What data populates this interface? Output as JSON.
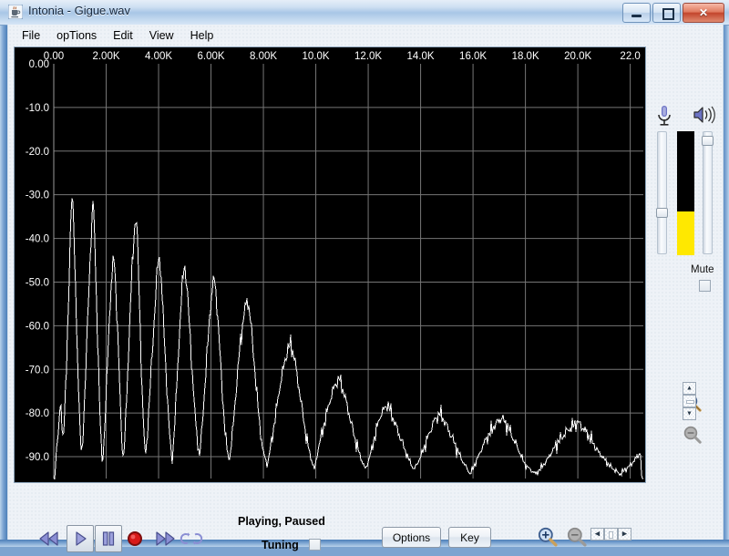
{
  "window": {
    "title": "Intonia - Gigue.wav",
    "icon": "java-cup-icon",
    "minimize_label": "Minimize",
    "maximize_label": "Maximize",
    "close_label": "Close",
    "close_glyph": "✕"
  },
  "menubar": {
    "items": [
      {
        "label": "File",
        "name": "menu-file"
      },
      {
        "label": "opTions",
        "name": "menu-options"
      },
      {
        "label": "Edit",
        "name": "menu-edit"
      },
      {
        "label": "View",
        "name": "menu-view"
      },
      {
        "label": "Help",
        "name": "menu-help"
      }
    ]
  },
  "chart_data": {
    "type": "line",
    "title": "",
    "xlabel": "",
    "ylabel": "",
    "xlim": [
      0,
      22500
    ],
    "ylim": [
      -95,
      0
    ],
    "grid": true,
    "legend": false,
    "background": "#000000",
    "line_color": "#ffffff",
    "grid_color": "#767676",
    "xticks": [
      0,
      2000,
      4000,
      6000,
      8000,
      10000,
      12000,
      14000,
      16000,
      18000,
      20000,
      22000
    ],
    "xtick_labels": [
      "0.00",
      "2.00K",
      "4.00K",
      "6.00K",
      "8.00K",
      "10.0K",
      "12.0K",
      "14.0K",
      "16.0K",
      "18.0K",
      "20.0K",
      "22.0"
    ],
    "yticks": [
      0,
      -10,
      -20,
      -30,
      -40,
      -50,
      -60,
      -70,
      -80,
      -90
    ],
    "ytick_labels": [
      "0.00",
      "-10.0",
      "-20.0",
      "-30.0",
      "-40.0",
      "-50.0",
      "-60.0",
      "-70.0",
      "-80.0",
      "-90.0"
    ],
    "series": [
      {
        "name": "spectrum",
        "x": [
          60,
          100,
          140,
          180,
          220,
          260,
          300,
          340,
          380,
          420,
          460,
          500,
          540,
          580,
          620,
          660,
          700,
          740,
          780,
          820,
          860,
          900,
          940,
          980,
          1020,
          1060,
          1100,
          1140,
          1180,
          1220,
          1260,
          1300,
          1340,
          1380,
          1420,
          1460,
          1500,
          1540,
          1580,
          1620,
          1660,
          1700,
          1740,
          1780,
          1820,
          1860,
          1900,
          1940,
          1980,
          2020,
          2060,
          2100,
          2140,
          2180,
          2220,
          2260,
          2300,
          2340,
          2380,
          2420,
          2460,
          2500,
          2540,
          2580,
          2620,
          2660,
          2700,
          2740,
          2780,
          2820,
          2860,
          2900,
          2940,
          2980,
          3020,
          3060,
          3100,
          3140,
          3180,
          3220,
          3260,
          3300,
          3340,
          3380,
          3420,
          3460,
          3500,
          3560,
          3620,
          3680,
          3740,
          3800,
          3860,
          3920,
          3980,
          4040,
          4100,
          4160,
          4220,
          4280,
          4340,
          4400,
          4460,
          4520,
          4580,
          4640,
          4700,
          4760,
          4820,
          4880,
          4940,
          5000,
          5080,
          5160,
          5240,
          5320,
          5400,
          5480,
          5560,
          5640,
          5720,
          5800,
          5880,
          5960,
          6040,
          6120,
          6200,
          6280,
          6360,
          6440,
          6520,
          6600,
          6700,
          6800,
          6900,
          7000,
          7100,
          7200,
          7300,
          7400,
          7500,
          7600,
          7700,
          7800,
          7900,
          8000,
          8150,
          8300,
          8450,
          8600,
          8750,
          8900,
          9050,
          9200,
          9350,
          9500,
          9650,
          9800,
          9950,
          10100,
          10300,
          10500,
          10700,
          10900,
          11100,
          11300,
          11500,
          11700,
          11900,
          12100,
          12300,
          12500,
          12750,
          13000,
          13250,
          13500,
          13750,
          14000,
          14250,
          14500,
          14750,
          15000,
          15300,
          15600,
          15900,
          16200,
          16500,
          16800,
          17100,
          17400,
          17700,
          18000,
          18400,
          18800,
          19200,
          19600,
          20000,
          20400,
          20800,
          21200,
          21600,
          22000,
          22400
        ],
        "y": [
          -93,
          -89,
          -86,
          -84,
          -80,
          -76,
          -82,
          -87,
          -84,
          -79,
          -72,
          -66,
          -60,
          -52,
          -42,
          -34,
          -28.5,
          -33,
          -41,
          -50,
          -58,
          -66,
          -73,
          -80,
          -86,
          -90,
          -87,
          -82,
          -76,
          -70,
          -64,
          -58,
          -52,
          -46,
          -40,
          -35.5,
          -31,
          -36,
          -44,
          -52,
          -60,
          -68,
          -76,
          -83,
          -89,
          -92,
          -88,
          -84,
          -79,
          -73,
          -67,
          -61,
          -56,
          -52,
          -49,
          -46,
          -44,
          -48,
          -53,
          -59,
          -65,
          -71,
          -78,
          -84,
          -88,
          -91,
          -87,
          -82,
          -77,
          -71,
          -65,
          -59,
          -53,
          -48,
          -44,
          -40,
          -36.5,
          -34.5,
          -38,
          -45,
          -53,
          -61,
          -69,
          -76,
          -82,
          -87,
          -90,
          -86,
          -80,
          -74,
          -68,
          -62,
          -56,
          -50,
          -45,
          -44.5,
          -49,
          -56,
          -63,
          -70,
          -77,
          -83,
          -88,
          -91,
          -86,
          -80,
          -73,
          -66,
          -59,
          -53,
          -48,
          -46,
          -51,
          -58,
          -66,
          -74,
          -81,
          -86,
          -90,
          -85,
          -78,
          -71,
          -64,
          -57,
          -52,
          -49,
          -53,
          -60,
          -68,
          -76,
          -83,
          -88,
          -91,
          -86,
          -79,
          -72,
          -65,
          -60,
          -56,
          -54,
          -58,
          -65,
          -72,
          -79,
          -85,
          -89,
          -92,
          -87,
          -81,
          -75,
          -70,
          -66,
          -64,
          -68,
          -74,
          -80,
          -86,
          -90,
          -93,
          -88,
          -83,
          -78,
          -74,
          -72,
          -76,
          -81,
          -86,
          -90,
          -93,
          -89,
          -84,
          -80,
          -78,
          -82,
          -86,
          -90,
          -93,
          -90,
          -86,
          -82,
          -80,
          -83,
          -87,
          -91,
          -94,
          -90,
          -86,
          -83,
          -81,
          -84,
          -88,
          -92,
          -94,
          -91,
          -87,
          -84,
          -82,
          -85,
          -89,
          -92,
          -94,
          -92,
          -89,
          -86,
          -84,
          -87,
          -90,
          -93,
          -95,
          -93,
          -91,
          -89,
          -88,
          -90,
          -92,
          -94,
          -95,
          -94,
          -93,
          -93,
          -94,
          -94,
          -95,
          -95,
          -95,
          -95,
          -95,
          -95
        ]
      }
    ]
  },
  "audio_panel": {
    "mic_icon": "microphone-icon",
    "speaker_icon": "speaker-icon",
    "mic_slider_value": 32,
    "speaker_slider_value": 97,
    "vu_meter_level": 35,
    "mute_label": "Mute",
    "mute_checked": false
  },
  "plot_tools": {
    "zoom_in_icon": "zoom-in-icon",
    "zoom_out_icon": "zoom-out-icon",
    "stepper_up_glyph": "▲",
    "stepper_down_glyph": "▼",
    "stepper_left_glyph": "◀",
    "stepper_right_glyph": "▶"
  },
  "transport": {
    "rewind_icon": "rewind-icon",
    "play_icon": "play-icon",
    "pause_icon": "pause-icon",
    "record_icon": "record-icon",
    "forward_icon": "fast-forward-icon",
    "loop_icon": "loop-icon",
    "record_color": "#d81919",
    "accent_color": "#8b8fd4"
  },
  "status_bar": {
    "status_text": "Playing, Paused",
    "tuning_label": "Tuning",
    "tuning_checked": false,
    "options_label": "Options",
    "key_label": "Key"
  }
}
